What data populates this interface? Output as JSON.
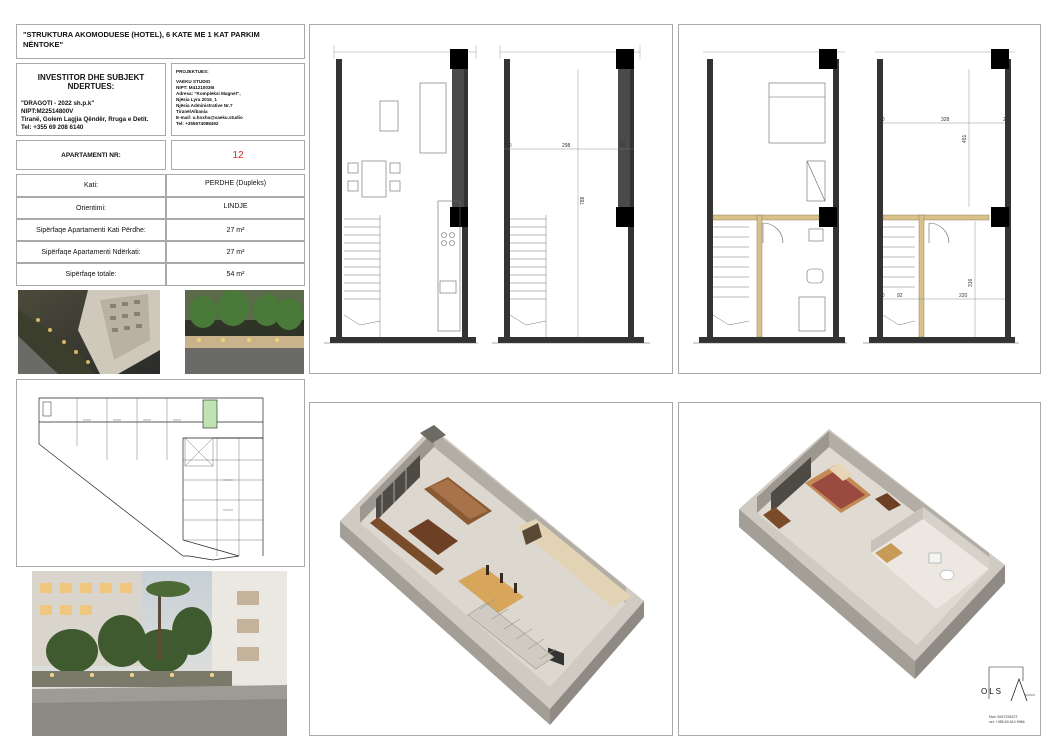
{
  "project_title": "\"STRUKTURA AKOMODUESE (HOTEL), 6 KATE ME 1 KAT PARKIM NËNTOKE\"",
  "investor": {
    "heading": "INVESTITOR DHE SUBJEKT NDERTUES:",
    "lines": [
      "\"DRAGOTI - 2022 sh.p.k\"",
      " NIPT:M22514800V",
      "Tiranë, Golem Lagjia Qëndër, Rruga e Detit.",
      "Tel: +355 69 208 6140"
    ]
  },
  "designer": {
    "heading": "PROJEKTUES:",
    "lines": [
      "VAEKU STUDIO",
      "NIPT: M41210036I",
      "Adresa: \"Kompleksi Magnet\",",
      "Njësia Lyra 2016_1",
      "Njësia Administrative Nr.7",
      "Tiranë/Albania",
      "E-mail: u.hoxha@vaeku.studio",
      "Tel: +355674088492"
    ]
  },
  "apartment": {
    "label": "APARTAMENTI NR:",
    "number": "12"
  },
  "rows": [
    {
      "label": "Kati:",
      "value": "PERDHE (Dupleks)"
    },
    {
      "label": "Orientimi:",
      "value": "LINDJE"
    },
    {
      "label": "Sipërfaqe Apartamenti Kati Përdhe:",
      "value": "27 m²"
    },
    {
      "label": "Sipërfaqe Apartamenti Ndërkati:",
      "value": "27 m²"
    },
    {
      "label": "Sipërfaqe totale:",
      "value": "54 m²"
    }
  ],
  "ground_plan_dims": {
    "width_total": "298",
    "side_a": "20",
    "side_b": "40",
    "height": "788"
  },
  "mezz_plan_dims": {
    "width": "328",
    "side_l": "20",
    "side_r": "20",
    "top_h": "451",
    "bottom_h": "316",
    "bot_w1": "92",
    "bot_w2": "220",
    "bot_side": "20"
  },
  "logo": {
    "text": "OLS",
    "note_1": "Nvd: 594722622T",
    "note_2": "cel: +355 69 614 9966"
  },
  "colors": {
    "frame": "#a9a9a9",
    "accent_red": "#e0261b",
    "wall": "#111111"
  }
}
